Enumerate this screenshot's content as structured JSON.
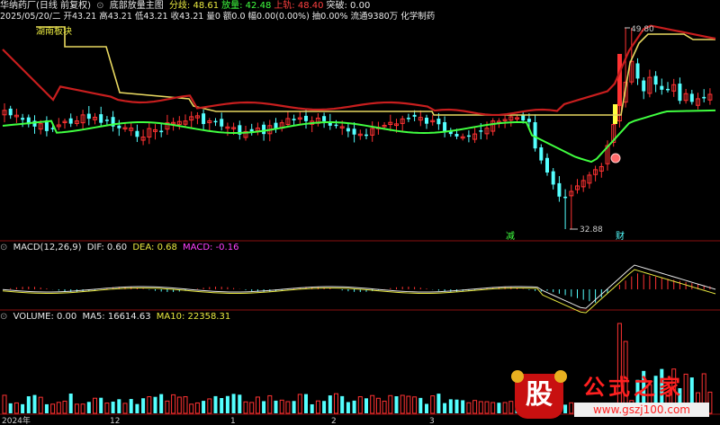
{
  "header": {
    "stock": "华纳药厂(日线 前复权)",
    "indicator": "底部放量主图",
    "items": [
      {
        "label": "分歧:",
        "value": "48.61",
        "color": "#e8e840"
      },
      {
        "label": "放量:",
        "value": "42.48",
        "color": "#40ff40"
      },
      {
        "label": "上轨:",
        "value": "48.40",
        "color": "#ff4040"
      },
      {
        "label": "突破:",
        "value": "0.00",
        "color": "#e8e8e8"
      }
    ],
    "info": "2025/05/20/二 开43.21 高43.21 低43.21 收43.21 量0 额0.0 幅0.00(0.00%) 抽0.00% 流通9380万 化学制药",
    "sector_tag": "湖南板块"
  },
  "price_labels": {
    "high": "49.80",
    "low": "32.88"
  },
  "signals": {
    "jian": "减",
    "cai": "财"
  },
  "macd": {
    "title": "MACD(12,26,9)",
    "dif": "DIF: 0.60",
    "dea": "DEA: 0.68",
    "macd": "MACD: -0.16"
  },
  "volume": {
    "title": "VOLUME: 0.00",
    "ma5": "MA5: 16614.63",
    "ma10": "MA10: 22358.31"
  },
  "xaxis": [
    "2024年",
    "12",
    "1",
    "2",
    "3"
  ],
  "watermark": {
    "glyph": "股",
    "text": "公式之家",
    "url": "www.gszj100.com"
  },
  "colors": {
    "up": "#ff3232",
    "down": "#54ffff",
    "ma_green": "#40ff40",
    "upper_red": "#c81e1e",
    "yellow": "#e8d860",
    "macd_purple": "#ff40ff"
  }
}
